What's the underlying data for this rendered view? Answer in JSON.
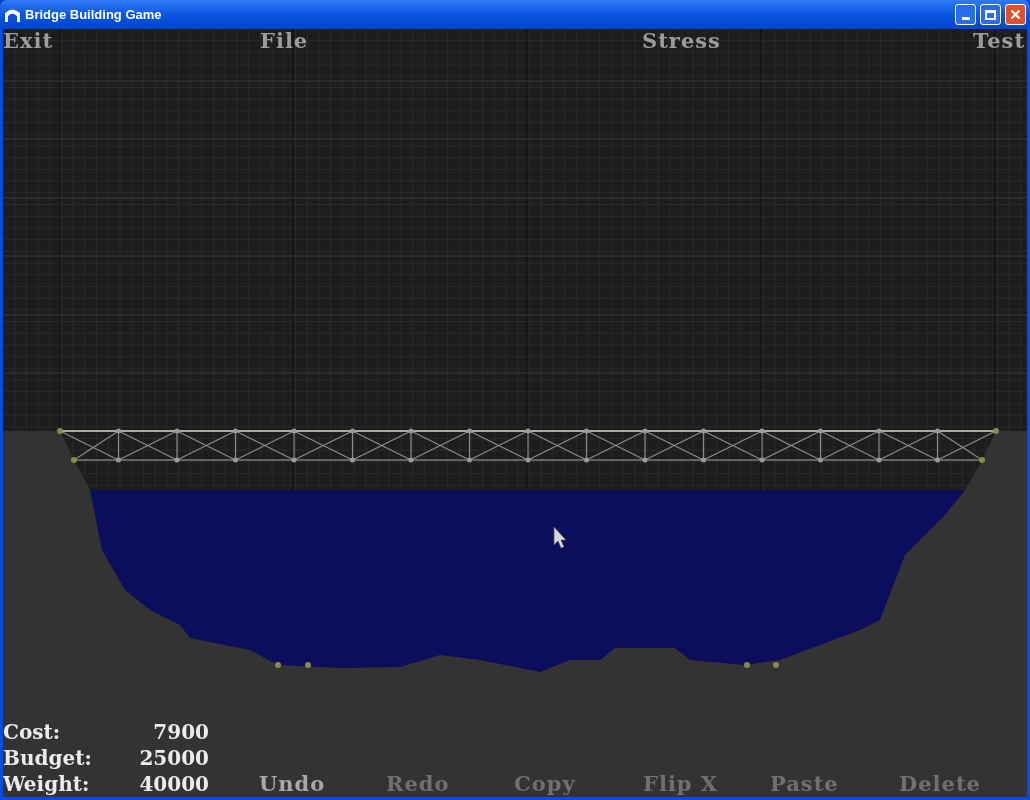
{
  "window": {
    "title": "Bridge Building Game"
  },
  "menu": [
    {
      "label": "Exit",
      "disabled": false
    },
    {
      "label": "File",
      "disabled": false
    },
    {
      "label": "Stress",
      "disabled": false
    },
    {
      "label": "Test",
      "disabled": false
    }
  ],
  "stats": [
    {
      "label": "Cost:",
      "value": "7900"
    },
    {
      "label": "Budget:",
      "value": "25000"
    },
    {
      "label": "Weight:",
      "value": "40000"
    }
  ],
  "edit_tools": [
    {
      "label": "Undo",
      "disabled": false
    },
    {
      "label": "Redo",
      "disabled": true
    },
    {
      "label": "Copy",
      "disabled": true
    },
    {
      "label": "Flip X",
      "disabled": true
    },
    {
      "label": "Paste",
      "disabled": true
    },
    {
      "label": "Delete",
      "disabled": true
    }
  ]
}
